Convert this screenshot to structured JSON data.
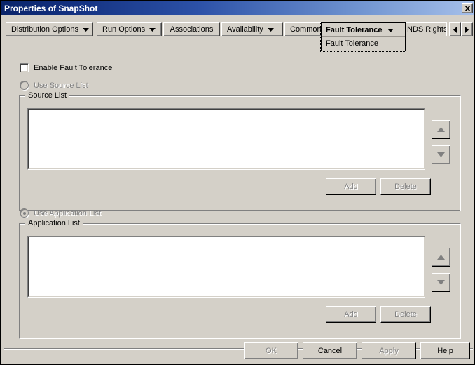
{
  "window": {
    "title": "Properties of SnapShot",
    "close_icon": "close-icon"
  },
  "tabs": {
    "items": [
      {
        "label": "Distribution Options",
        "has_dropdown": true,
        "selected": false
      },
      {
        "label": "Run Options",
        "has_dropdown": true,
        "selected": false
      },
      {
        "label": "Associations",
        "has_dropdown": false,
        "selected": false
      },
      {
        "label": "Availability",
        "has_dropdown": true,
        "selected": false
      },
      {
        "label": "Common",
        "has_dropdown": true,
        "selected": false
      },
      {
        "label": "Fault Tolerance",
        "has_dropdown": true,
        "selected": true
      },
      {
        "label": "NDS Rights",
        "has_dropdown": false,
        "selected": false
      }
    ],
    "selected_tab": "Fault Tolerance",
    "selected_tab_menu_item": "Fault Tolerance",
    "scroll_left_icon": "triangle-left-icon",
    "scroll_right_icon": "triangle-right-icon"
  },
  "form": {
    "enable_fault_tolerance": {
      "label": "Enable Fault Tolerance",
      "checked": false,
      "enabled": true
    },
    "use_source_list": {
      "label": "Use Source List",
      "selected": false,
      "enabled": false
    },
    "use_application_list": {
      "label": "Use Application List",
      "selected": true,
      "enabled": false
    },
    "source_group": {
      "title": "Source List",
      "items": [],
      "add_label": "Add",
      "delete_label": "Delete",
      "add_enabled": false,
      "delete_enabled": false,
      "move_up_icon": "triangle-up-icon",
      "move_down_icon": "triangle-down-icon"
    },
    "application_group": {
      "title": "Application List",
      "items": [],
      "add_label": "Add",
      "delete_label": "Delete",
      "add_enabled": false,
      "delete_enabled": false,
      "move_up_icon": "triangle-up-icon",
      "move_down_icon": "triangle-down-icon"
    }
  },
  "footer": {
    "ok_label": "OK",
    "cancel_label": "Cancel",
    "apply_label": "Apply",
    "help_label": "Help",
    "ok_enabled": false,
    "cancel_enabled": true,
    "apply_enabled": false,
    "help_enabled": true
  },
  "colors": {
    "face": "#d4d0c8",
    "title_start": "#0a246a",
    "title_end": "#a6c0ea",
    "disabled_text": "#808080",
    "text": "#000000",
    "field": "#ffffff"
  }
}
